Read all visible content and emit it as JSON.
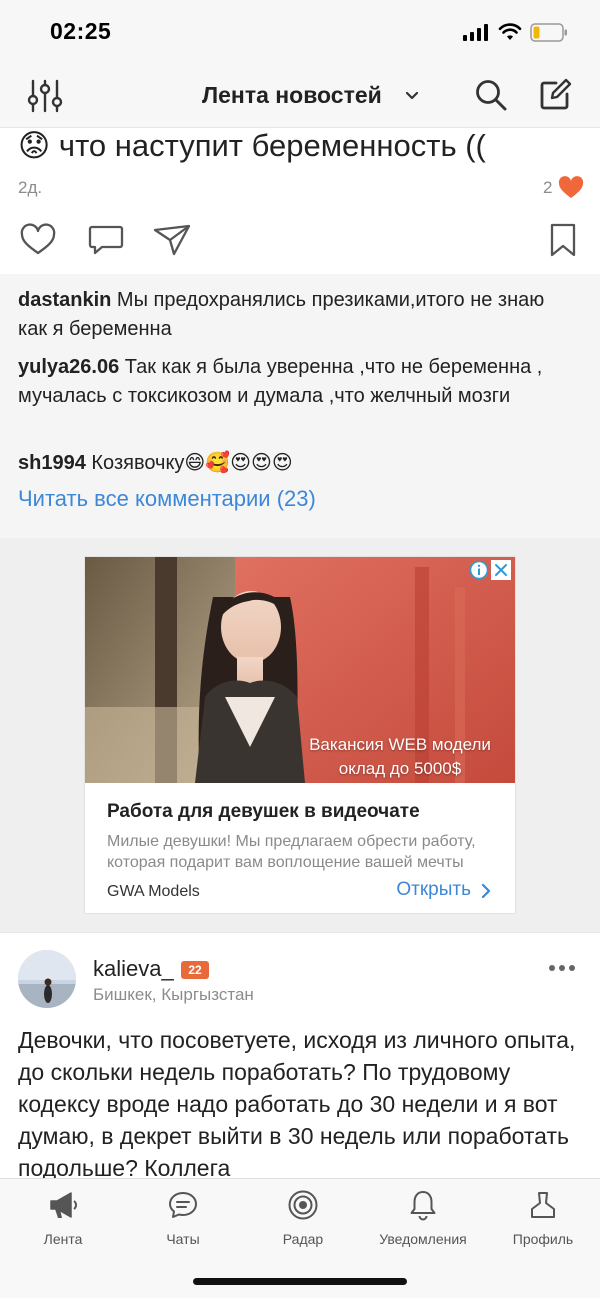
{
  "status_bar": {
    "time": "02:25"
  },
  "header": {
    "title": "Лента новостей"
  },
  "post1": {
    "text_fragment": "😟 что наступит беременность ((",
    "time": "2д.",
    "likes": "2"
  },
  "comments": [
    {
      "user": "dastankin",
      "text": " Мы предохранялись презиками,итого не знаю как я беременна"
    },
    {
      "user": "yulya26.06",
      "text": " Так как я была уверенна ,что не беременна , мучалась с токсикозом и думала ,что желчный мозги"
    },
    {
      "user": "sh1994",
      "text": " Козявочку😄🥰😍😍😍"
    }
  ],
  "read_all": "Читать все комментарии (23)",
  "ad": {
    "overlay_line1": "Вакансия WEB модели",
    "overlay_line2": "оклад до 5000$",
    "headline": "Работа для девушек в видеочате",
    "description": "Милые девушки! Мы предлагаем обрести работу, которая подарит вам воплощение вашей мечты",
    "brand": "GWA Models",
    "cta": "Открыть"
  },
  "post2": {
    "author": "kalieva_",
    "badge": "22",
    "location": "Бишкек, Кыргызстан",
    "text": "Девочки, что посоветуете, исходя из личного опыта, до скольки недель поработать? По трудовому кодексу вроде надо работать до 30 недели и я вот думаю, в декрет выйти в 30 недель или поработать подольше? Коллега"
  },
  "tabs": [
    {
      "label": "Лента",
      "icon": "megaphone-icon",
      "active": true
    },
    {
      "label": "Чаты",
      "icon": "chat-icon"
    },
    {
      "label": "Радар",
      "icon": "radar-icon"
    },
    {
      "label": "Уведомления",
      "icon": "bell-icon"
    },
    {
      "label": "Профиль",
      "icon": "profile-icon"
    }
  ],
  "colors": {
    "accent": "#3d88d6",
    "heart": "#f0683a",
    "badge": "#e86a3a"
  }
}
